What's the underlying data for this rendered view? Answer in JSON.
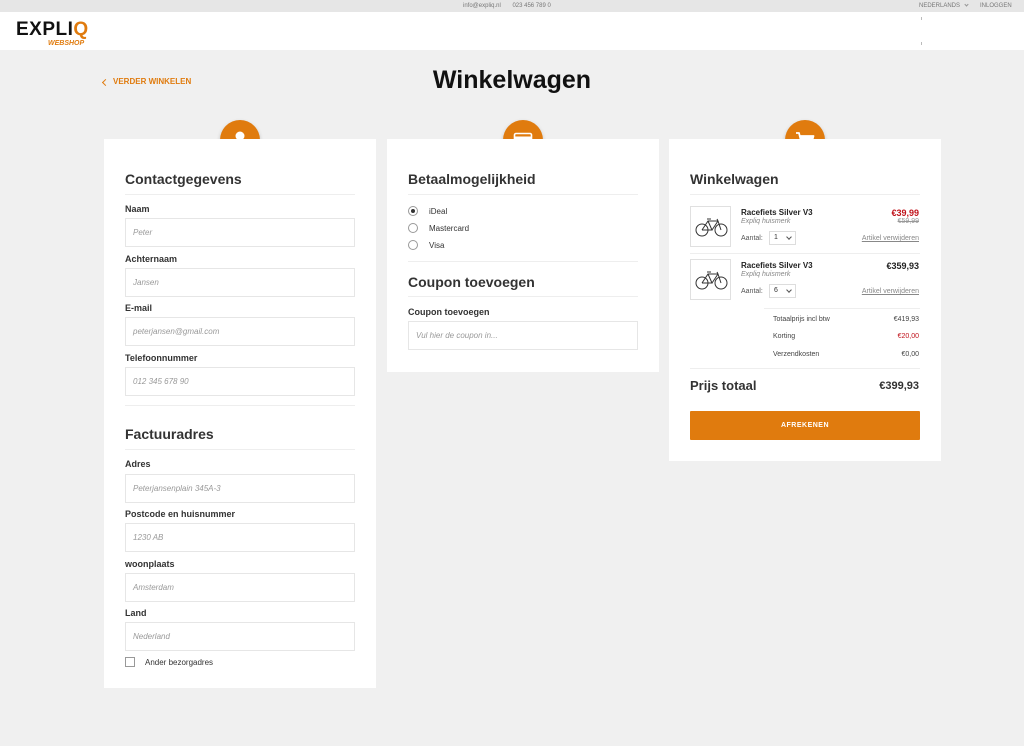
{
  "topbar": {
    "email": "info@expliq.nl",
    "phone": "023 456 789 0",
    "language": "NEDERLANDS",
    "login": "INLOGGEN"
  },
  "brand": {
    "logo_main": "EXPLI",
    "logo_accent": "Q",
    "logo_sub": "WEBSHOP"
  },
  "nav": {
    "back_label": "VERDER WINKELEN"
  },
  "page": {
    "title": "Winkelwagen"
  },
  "contact": {
    "title": "Contactgegevens",
    "fields": [
      {
        "label": "Naam",
        "placeholder": "Peter"
      },
      {
        "label": "Achternaam",
        "placeholder": "Jansen"
      },
      {
        "label": "E-mail",
        "placeholder": "peterjansen@gmail.com"
      },
      {
        "label": "Telefoonnummer",
        "placeholder": "012 345 678 90"
      }
    ]
  },
  "billing": {
    "title": "Factuuradres",
    "fields": [
      {
        "label": "Adres",
        "placeholder": "Peterjansenplain 345A-3"
      },
      {
        "label": "Postcode en huisnummer",
        "placeholder": "1230 AB"
      },
      {
        "label": "woonplaats",
        "placeholder": "Amsterdam"
      },
      {
        "label": "Land",
        "placeholder": "Nederland"
      }
    ],
    "other_address_label": "Ander bezorgadres"
  },
  "payment": {
    "title": "Betaalmogelijkheid",
    "options": [
      "iDeal",
      "Mastercard",
      "Visa"
    ],
    "selected": "iDeal"
  },
  "coupon": {
    "title": "Coupon toevoegen",
    "label": "Coupon toevoegen",
    "placeholder": "Vul hier de coupon in..."
  },
  "cart": {
    "title": "Winkelwagen",
    "items": [
      {
        "name": "Racefiets Silver V3",
        "brand": "Expliq huismerk",
        "price": "€39,99",
        "old_price": "€59,99",
        "qty_label": "Aantal:",
        "qty": "1",
        "remove": "Artikel verwijderen"
      },
      {
        "name": "Racefiets Silver V3",
        "brand": "Expliq huismerk",
        "price": "€359,93",
        "old_price": "",
        "qty_label": "Aantal:",
        "qty": "6",
        "remove": "Artikel verwijderen"
      }
    ],
    "summary": [
      {
        "label": "Totaalprijs incl btw",
        "value": "€419,93"
      },
      {
        "label": "Korting",
        "value": "€20,00"
      },
      {
        "label": "Verzendkosten",
        "value": "€0,00"
      }
    ],
    "total_label": "Prijs totaal",
    "total_value": "€399,93",
    "checkout_label": "AFREKENEN"
  },
  "colors": {
    "accent": "#e07b0e",
    "discount": "#c0121a",
    "background": "#f0f0f0"
  },
  "icons": {
    "contact": "user-icon",
    "payment": "credit-card-icon",
    "cart": "shopping-cart-icon",
    "product": "bicycle-icon"
  }
}
